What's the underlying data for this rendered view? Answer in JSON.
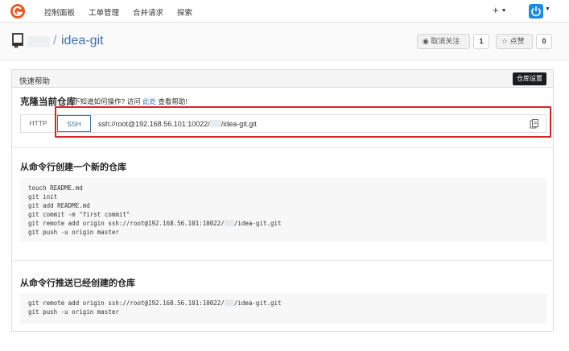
{
  "nav": {
    "items": [
      "控制面板",
      "工单管理",
      "合并请求",
      "探索"
    ],
    "plus": "+",
    "accent": "#1e88e5"
  },
  "repo": {
    "separator": "/",
    "name": "idea-git",
    "unwatch_label": "取消关注",
    "watch_count": "1",
    "star_label": "点赞",
    "star_count": "0"
  },
  "panel": {
    "title": "快速帮助",
    "settings_label": "仓库设置",
    "clone_title": "克隆当前仓库",
    "hint_prefix": "不知道如何操作? 访问",
    "hint_link": "此处",
    "hint_suffix": "查看帮助!",
    "http_label": "HTTP",
    "ssh_label": "SSH",
    "url_prefix": "ssh://root@192.168.56.101:10022/",
    "url_suffix": "/idea-git.git",
    "highlight_color": "#d9232b"
  },
  "new_repo": {
    "title": "从命令行创建一个新的仓库",
    "lines": [
      "touch README.md",
      "git init",
      "git add README.md",
      "git commit -m \"first commit\"",
      "git remote add origin ssh://root@192.168.56.101:10022/",
      "git push -u origin master"
    ],
    "remote_suffix": "/idea-git.git"
  },
  "push_existing": {
    "title": "从命令行推送已经创建的仓库",
    "line1_prefix": "git remote add origin ssh://root@192.168.56.101:10022/",
    "line1_suffix": "/idea-git.git",
    "line2": "git push -u origin master"
  }
}
